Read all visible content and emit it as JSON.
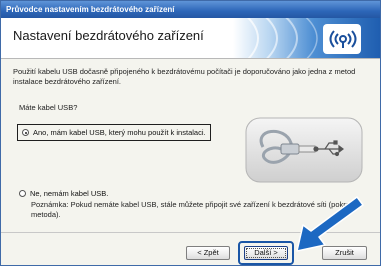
{
  "window": {
    "title": "Průvodce nastavením bezdrátového zařízení",
    "header_title": "Nastavení bezdrátového zařízení",
    "description": "Použití kabelu USB dočasně připojeného k bezdrátovému počítači je doporučováno jako jedna z metod instalace bezdrátového zařízení.",
    "question": "Máte kabel USB?",
    "options": [
      {
        "label": "Ano, mám kabel USB, který mohu použít k instalaci.",
        "selected": true
      },
      {
        "label": "Ne, nemám kabel USB.",
        "selected": false
      }
    ],
    "note": "Poznámka: Pokud nemáte kabel USB, stále můžete připojit své zařízení k bezdrátové síti (pokročilá metoda).",
    "buttons": {
      "back": "< Zpět",
      "next": "Další >",
      "cancel": "Zrušit"
    }
  },
  "icons": {
    "logo": "wireless-logo-icon",
    "usb": "usb-cable-icon",
    "arrow": "pointer-arrow-icon"
  },
  "colors": {
    "titlebar": "#2d66b8",
    "accent": "#1f5eb0",
    "arrow": "#1c68c2",
    "background": "#f4f4ee"
  }
}
